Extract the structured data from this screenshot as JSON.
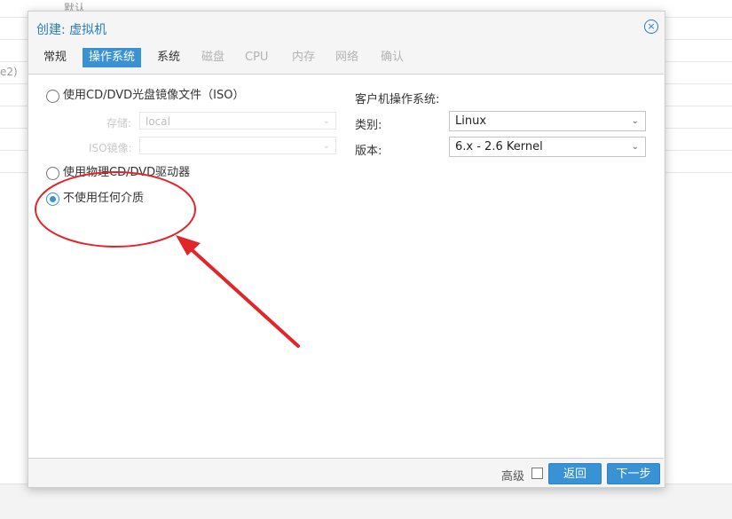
{
  "background": {
    "top_text": "默认",
    "side_text": "e2)"
  },
  "dialog": {
    "title": "创建: 虚拟机",
    "close_glyph": "×",
    "tabs": [
      {
        "label": "常规",
        "state": "normal"
      },
      {
        "label": "操作系统",
        "state": "active"
      },
      {
        "label": "系统",
        "state": "normal"
      },
      {
        "label": "磁盘",
        "state": "disabled"
      },
      {
        "label": "CPU",
        "state": "disabled"
      },
      {
        "label": "内存",
        "state": "disabled"
      },
      {
        "label": "网络",
        "state": "disabled"
      },
      {
        "label": "确认",
        "state": "disabled"
      }
    ]
  },
  "media": {
    "option_iso": {
      "label": "使用CD/DVD光盘镜像文件（ISO）",
      "checked": false
    },
    "storage": {
      "label": "存储:",
      "value": "local"
    },
    "iso_image": {
      "label": "ISO镜像:",
      "value": ""
    },
    "option_physical": {
      "label": "使用物理CD/DVD驱动器",
      "checked": false
    },
    "option_none": {
      "label": "不使用任何介质",
      "checked": true
    }
  },
  "guest_os": {
    "heading": "客户机操作系统:",
    "type_label": "类别:",
    "type_value": "Linux",
    "version_label": "版本:",
    "version_value": "6.x - 2.6 Kernel"
  },
  "footer": {
    "advanced_label": "高级",
    "advanced_checked": false,
    "back_label": "返回",
    "next_label": "下一步"
  },
  "colors": {
    "accent": "#3892d4",
    "title": "#2a7ac0",
    "annotation": "#e0262b"
  }
}
